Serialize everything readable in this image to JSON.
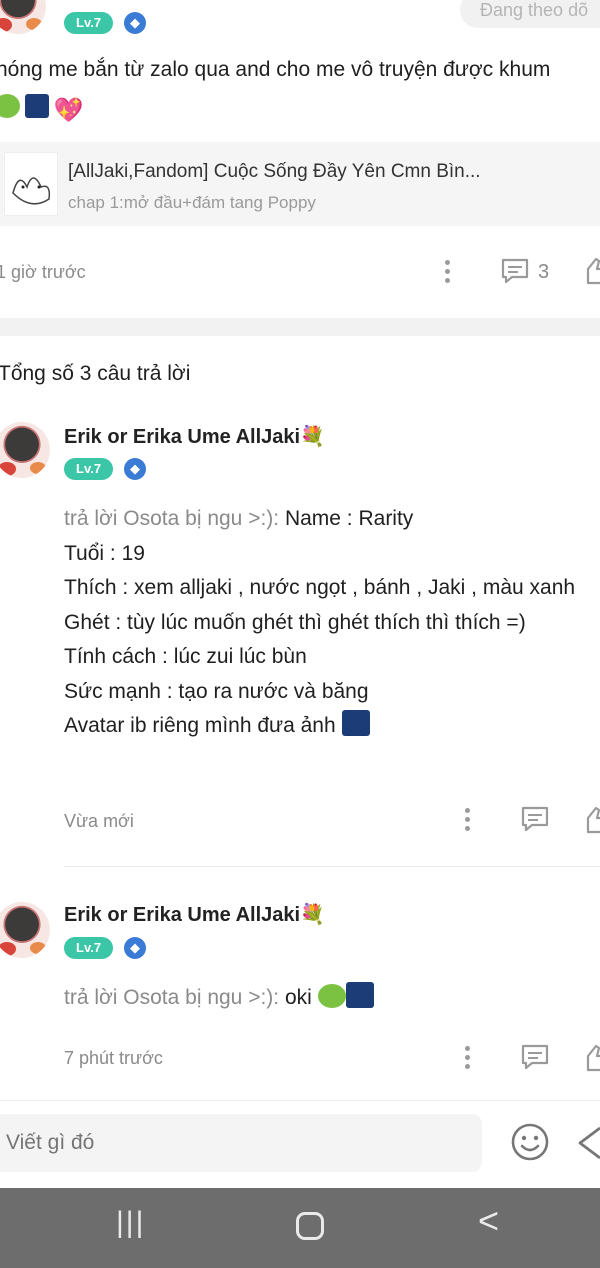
{
  "top_post": {
    "level": "Lv.7",
    "follow_button": "Đang theo dõ",
    "text": "hóng me bắn từ zalo qua and cho me vô truyện được khum",
    "emoji_icons": [
      "frog-icon",
      "fireworks-icon",
      "sparkling-heart-icon"
    ],
    "story_card": {
      "title": "[AllJaki,Fandom] Cuộc Sống Đầy Yên Cmn Bìn...",
      "chapter": "chap 1:mở đầu+đám tang Poppy"
    },
    "time": "1 giờ trước",
    "comment_count": "3"
  },
  "replies_header": "Tổng số 3 câu trả lời",
  "replies": [
    {
      "name": "Erik or Erika Ume AllJaki",
      "level": "Lv.7",
      "reply_prefix": "trả lời Osota bị ngu >:): ",
      "lines": [
        "Name : Rarity",
        "Tuổi : 19",
        "Thích : xem alljaki , nước ngọt , bánh , Jaki , màu xanh",
        "Ghét : tùy lúc muốn ghét thì ghét thích thì thích =)",
        "Tính cách : lúc zui lúc bùn",
        "Sức mạnh : tạo ra nước và băng",
        "Avatar ib riêng mình đưa ảnh"
      ],
      "time": "Vừa mới"
    },
    {
      "name": "Erik or Erika Ume AllJaki",
      "level": "Lv.7",
      "reply_prefix": "trả lời Osota bị ngu >:): ",
      "text": "oki",
      "time": "7 phút trước"
    }
  ],
  "composer": {
    "placeholder": "Viết gì đó"
  },
  "nav": {
    "recent": "|||",
    "home": "○",
    "back": "<"
  },
  "colors": {
    "level_badge": "#3cc6a8",
    "verified_badge": "#3a7bd5",
    "nav_bar": "#6d6d6d"
  }
}
